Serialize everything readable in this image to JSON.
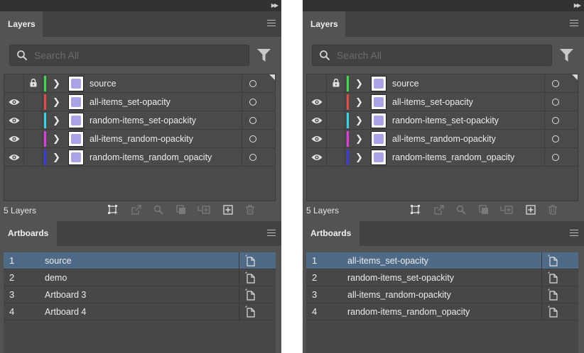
{
  "panels": [
    {
      "layers": {
        "tab_label": "Layers",
        "search_placeholder": "Search All",
        "count_label": "5 Layers",
        "items": [
          {
            "name": "source",
            "color": "#3ddc4a",
            "visible": false,
            "locked": true
          },
          {
            "name": "all-items_set-opacity",
            "color": "#e84a4a",
            "visible": true,
            "locked": false
          },
          {
            "name": "random-items_set-opackity",
            "color": "#36d6e6",
            "visible": true,
            "locked": false
          },
          {
            "name": "all-items_random-opackity",
            "color": "#e03ae0",
            "visible": true,
            "locked": false
          },
          {
            "name": "random-items_random_opacity",
            "color": "#3a3ae6",
            "visible": true,
            "locked": false
          }
        ]
      },
      "artboards": {
        "tab_label": "Artboards",
        "items": [
          {
            "num": "1",
            "name": "source",
            "selected": true
          },
          {
            "num": "2",
            "name": "demo",
            "selected": false
          },
          {
            "num": "3",
            "name": "Artboard 3",
            "selected": false
          },
          {
            "num": "4",
            "name": "Artboard 4",
            "selected": false
          }
        ]
      }
    },
    {
      "layers": {
        "tab_label": "Layers",
        "search_placeholder": "Search All",
        "count_label": "5 Layers",
        "items": [
          {
            "name": "source",
            "color": "#3ddc4a",
            "visible": false,
            "locked": true
          },
          {
            "name": "all-items_set-opacity",
            "color": "#e84a4a",
            "visible": true,
            "locked": false
          },
          {
            "name": "random-items_set-opackity",
            "color": "#36d6e6",
            "visible": true,
            "locked": false
          },
          {
            "name": "all-items_random-opackity",
            "color": "#e03ae0",
            "visible": true,
            "locked": false
          },
          {
            "name": "random-items_random_opacity",
            "color": "#3a3ae6",
            "visible": true,
            "locked": false
          }
        ]
      },
      "artboards": {
        "tab_label": "Artboards",
        "items": [
          {
            "num": "1",
            "name": "all-items_set-opacity",
            "selected": true
          },
          {
            "num": "2",
            "name": "random-items_set-opackity",
            "selected": false
          },
          {
            "num": "3",
            "name": "all-items_random-opackity",
            "selected": false
          },
          {
            "num": "4",
            "name": "random-items_random_opacity",
            "selected": false
          }
        ]
      }
    }
  ],
  "icons": {
    "collapse": "double-chevron-right-icon",
    "menu": "hamburger-menu-icon",
    "search": "search-icon",
    "filter": "filter-icon",
    "eye": "eye-icon",
    "lock": "lock-icon",
    "expand": "chevron-right-icon",
    "target": "target-circle-icon",
    "artboard_options": "artboard-options-icon",
    "footer": [
      "collect-for-export-icon",
      "export-icon",
      "locate-object-icon",
      "clipping-mask-icon",
      "new-sublayer-icon",
      "new-layer-icon",
      "delete-icon"
    ]
  },
  "theme": {
    "panel_bg": "#535353",
    "header_bg": "#424242",
    "selected_row": "#4f6a86"
  }
}
